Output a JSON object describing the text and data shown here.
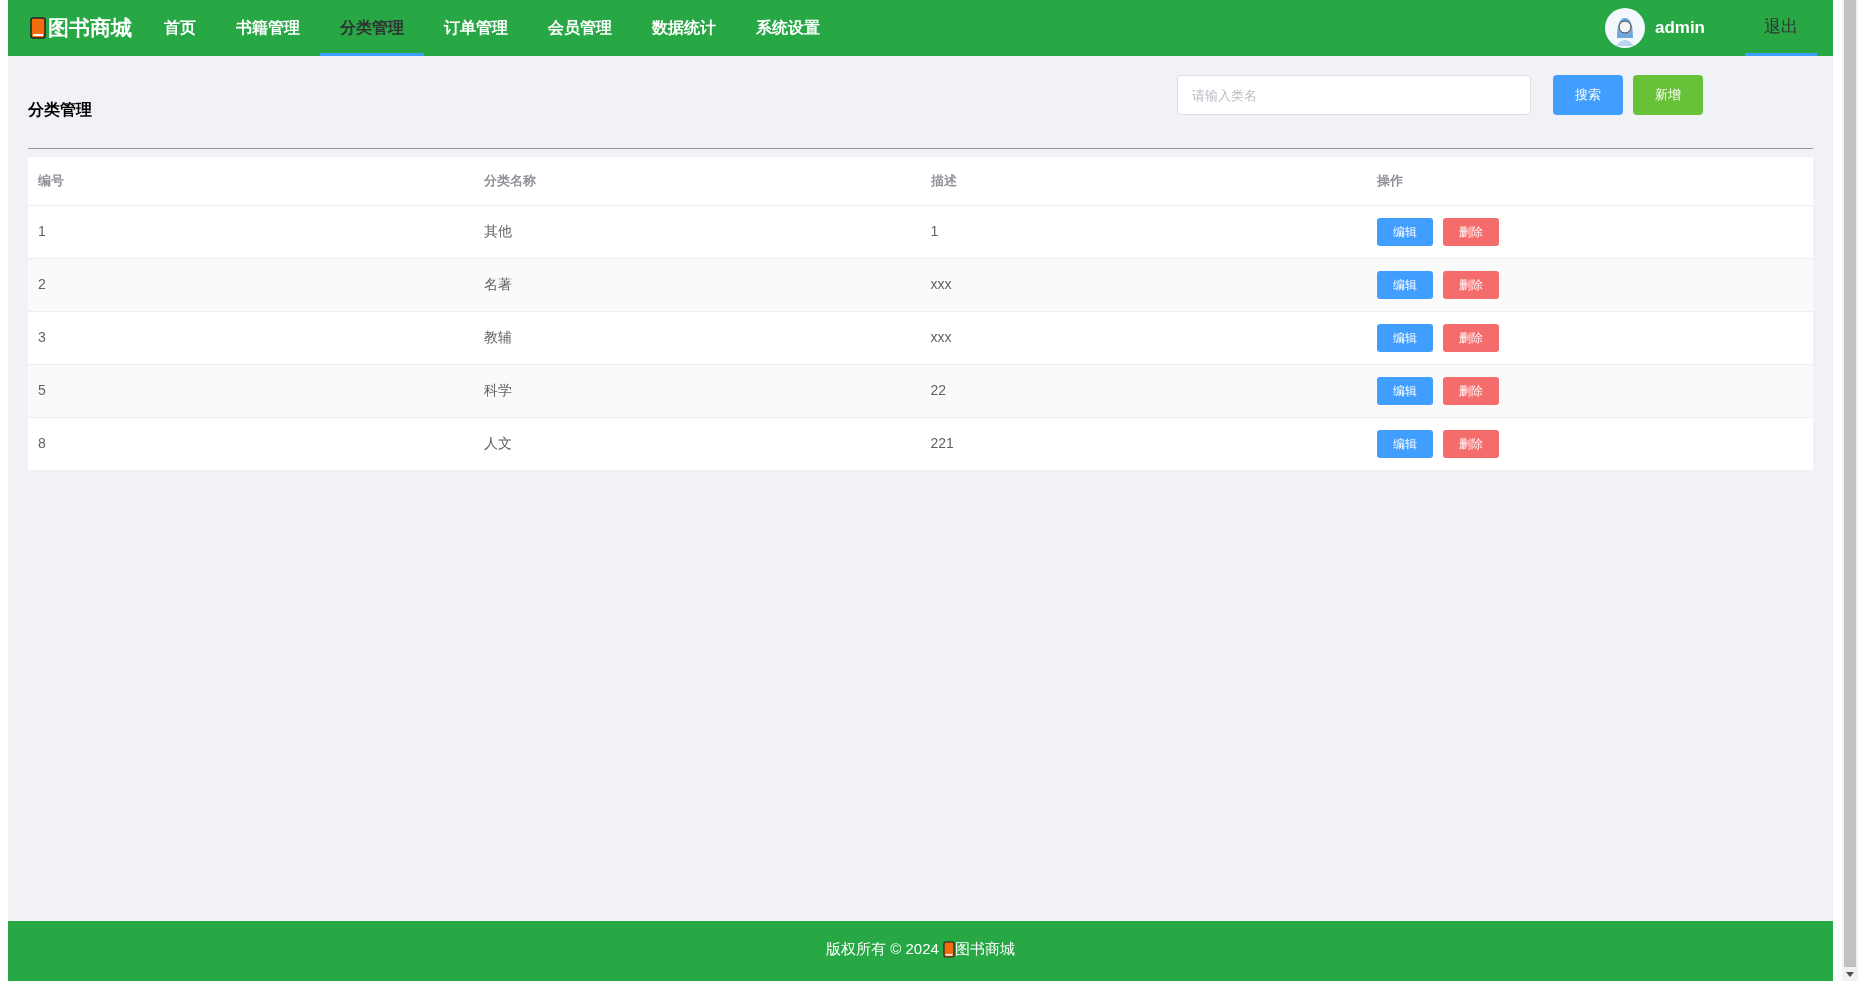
{
  "header": {
    "logo": "图书商城",
    "nav": [
      {
        "label": "首页",
        "selected": false
      },
      {
        "label": "书籍管理",
        "selected": false
      },
      {
        "label": "分类管理",
        "selected": true
      },
      {
        "label": "订单管理",
        "selected": false
      },
      {
        "label": "会员管理",
        "selected": false
      },
      {
        "label": "数据统计",
        "selected": false
      },
      {
        "label": "系统设置",
        "selected": false
      }
    ],
    "user": "admin",
    "logout": {
      "label": "退出",
      "active": true
    }
  },
  "page": {
    "title": "分类管理",
    "search": {
      "placeholder": "请输入类名"
    },
    "search_button": "搜索",
    "add_button": "新增"
  },
  "table": {
    "columns": [
      "编号",
      "分类名称",
      "描述",
      "操作"
    ],
    "rows": [
      {
        "id": "1",
        "name": "其他",
        "description": "1",
        "edit": "编辑",
        "delete": "删除"
      },
      {
        "id": "2",
        "name": "名著",
        "description": "xxx",
        "edit": "编辑",
        "delete": "删除"
      },
      {
        "id": "3",
        "name": "教辅",
        "description": "xxx",
        "edit": "编辑",
        "delete": "删除"
      },
      {
        "id": "5",
        "name": "科学",
        "description": "22",
        "edit": "编辑",
        "delete": "删除"
      },
      {
        "id": "8",
        "name": "人文",
        "description": "221",
        "edit": "编辑",
        "delete": "删除"
      }
    ]
  },
  "footer": {
    "text": "版权所有 © 2024",
    "brand": "图书商城"
  }
}
